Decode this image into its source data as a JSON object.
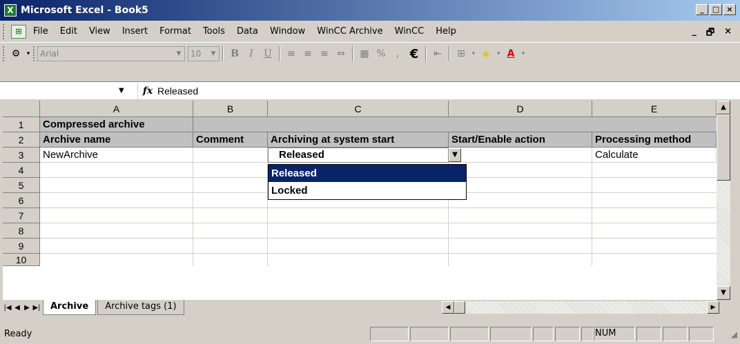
{
  "window": {
    "title": "Microsoft Excel - Book5",
    "app_icon": "X",
    "controls": [
      "_",
      "□",
      "×"
    ]
  },
  "menubar": {
    "items": [
      "File",
      "Edit",
      "View",
      "Insert",
      "Format",
      "Tools",
      "Data",
      "Window",
      "WinCC Archive",
      "WinCC",
      "Help"
    ],
    "doc_controls": [
      "_",
      "🗗",
      "×"
    ]
  },
  "toolbar": {
    "font": "Arial",
    "size": "10",
    "bold": "B",
    "italic": "I",
    "underline": "U",
    "percent": "%",
    "comma": ",",
    "euro": "€"
  },
  "formula_bar": {
    "name_box": "",
    "fx": "fx",
    "content": "Released"
  },
  "grid": {
    "columns": [
      "A",
      "B",
      "C",
      "D",
      "E"
    ],
    "rows": [
      "1",
      "2",
      "3",
      "4",
      "5",
      "6",
      "7",
      "8",
      "9",
      "10"
    ],
    "row1": {
      "a": "Compressed archive"
    },
    "row2": {
      "a": "Archive name",
      "b": "Comment",
      "c": "Archiving at system start",
      "d": "Start/Enable action",
      "e": "Processing method"
    },
    "row3": {
      "a": "NewArchive",
      "e": "Calculate"
    }
  },
  "dropdown": {
    "value": "Released",
    "options": [
      "Released",
      "Locked"
    ],
    "selected_index": 0
  },
  "sheets": {
    "tabs": [
      "Archive",
      "Archive tags (1)"
    ],
    "active": "Archive"
  },
  "status": {
    "text": "Ready",
    "num": "NUM"
  }
}
